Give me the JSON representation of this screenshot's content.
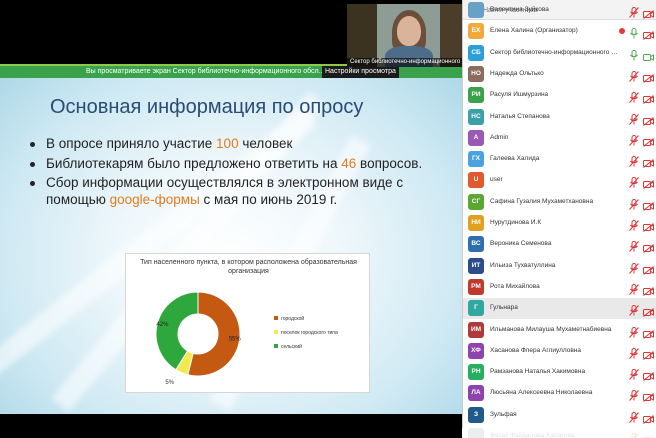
{
  "share_banner": {
    "message": "Вы просматриваете экран Сектор библиотечно-информационного обсл...",
    "settings": "Настройки просмотра"
  },
  "video": {
    "label": "Сектор библиотечно-информационного о..."
  },
  "slide": {
    "title": "Основная информация по опросу",
    "bullets": [
      {
        "pre": "В опросе приняло участие ",
        "hl": "100",
        "post": " человек"
      },
      {
        "pre": "Библиотекарям было предложено ответить на ",
        "hl": "46",
        "post": " вопросов."
      },
      {
        "pre": "Сбор информации осуществлялся в электронном виде с помощью ",
        "hl": "google-формы",
        "post": " с мая по июнь 2019 г."
      }
    ]
  },
  "chart_data": {
    "type": "pie",
    "title": "Тип населенного пункта, в котором расположена образовательная организация",
    "donut": true,
    "categories": [
      "городской",
      "поселок городского типа",
      "сельский"
    ],
    "values": [
      55,
      5,
      42
    ],
    "labels": [
      "55%",
      "5%",
      "42%"
    ],
    "colors": [
      "#c45a12",
      "#f2e94e",
      "#2ea83c"
    ],
    "legend_position": "right"
  },
  "participants": {
    "search_placeholder": "Найти участника",
    "items": [
      {
        "initials": "",
        "name": "Валентина Зуйкова",
        "color": "#6aa0c6",
        "muted": true,
        "video_off": true
      },
      {
        "initials": "ЕХ",
        "name": "Елена Халина (Организатор)",
        "color": "#f2a93b",
        "muted": false,
        "video_off": true,
        "recording": true
      },
      {
        "initials": "СБ",
        "name": "Сектор библиотечно-информационного обсл...",
        "color": "#2d9fd8",
        "muted": false,
        "video_off": false
      },
      {
        "initials": "НО",
        "name": "Надежда Ольтько",
        "color": "#8a6d5a",
        "muted": true,
        "video_off": true
      },
      {
        "initials": "РИ",
        "name": "Расуля Ишмурзина",
        "color": "#39a24a",
        "muted": true,
        "video_off": true
      },
      {
        "initials": "НС",
        "name": "Наталья Степанова",
        "color": "#3aa1a8",
        "muted": true,
        "video_off": true
      },
      {
        "initials": "A",
        "name": "Admin",
        "color": "#9b59b6",
        "muted": true,
        "video_off": true
      },
      {
        "initials": "ГХ",
        "name": "Галеева Халида",
        "color": "#4aa3df",
        "muted": true,
        "video_off": true
      },
      {
        "initials": "U",
        "name": "user",
        "color": "#e05a2b",
        "muted": true,
        "video_off": true
      },
      {
        "initials": "СГ",
        "name": "Сафина Гузалия Мухаметхановна",
        "color": "#5aa832",
        "muted": true,
        "video_off": true
      },
      {
        "initials": "НИ",
        "name": "Нурутдинова И.К",
        "color": "#e0a020",
        "muted": true,
        "video_off": true
      },
      {
        "initials": "ВС",
        "name": "Вероника Семенова",
        "color": "#2f6fb0",
        "muted": true,
        "video_off": true
      },
      {
        "initials": "ИТ",
        "name": "Ильиза Тухватуллина",
        "color": "#2d4d8a",
        "muted": true,
        "video_off": true
      },
      {
        "initials": "РМ",
        "name": "Рота Михайлова",
        "color": "#c0392b",
        "muted": true,
        "video_off": true
      },
      {
        "initials": "Г",
        "name": "Гульнара",
        "color": "#2ea8a0",
        "muted": true,
        "video_off": true
      },
      {
        "initials": "ИМ",
        "name": "Ильманова Милауша Мухаметнабиевна",
        "color": "#b03a3a",
        "muted": true,
        "video_off": true
      },
      {
        "initials": "ХФ",
        "name": "Хасанова Флера Аглиулловна",
        "color": "#8e44ad",
        "muted": true,
        "video_off": true
      },
      {
        "initials": "РН",
        "name": "Рамзанова Наталья Хакимовна",
        "color": "#27ae60",
        "muted": true,
        "video_off": true
      },
      {
        "initials": "ЛА",
        "name": "Люсьяна Алексеевна Николаевна",
        "color": "#8e44ad",
        "muted": true,
        "video_off": true
      },
      {
        "initials": "З",
        "name": "Зульфая",
        "color": "#1f5a8a",
        "muted": true,
        "video_off": true
      },
      {
        "initials": "",
        "name": "Фатах Файдалова Халатова",
        "color": "#7a8a99",
        "muted": true,
        "video_off": true
      }
    ]
  }
}
